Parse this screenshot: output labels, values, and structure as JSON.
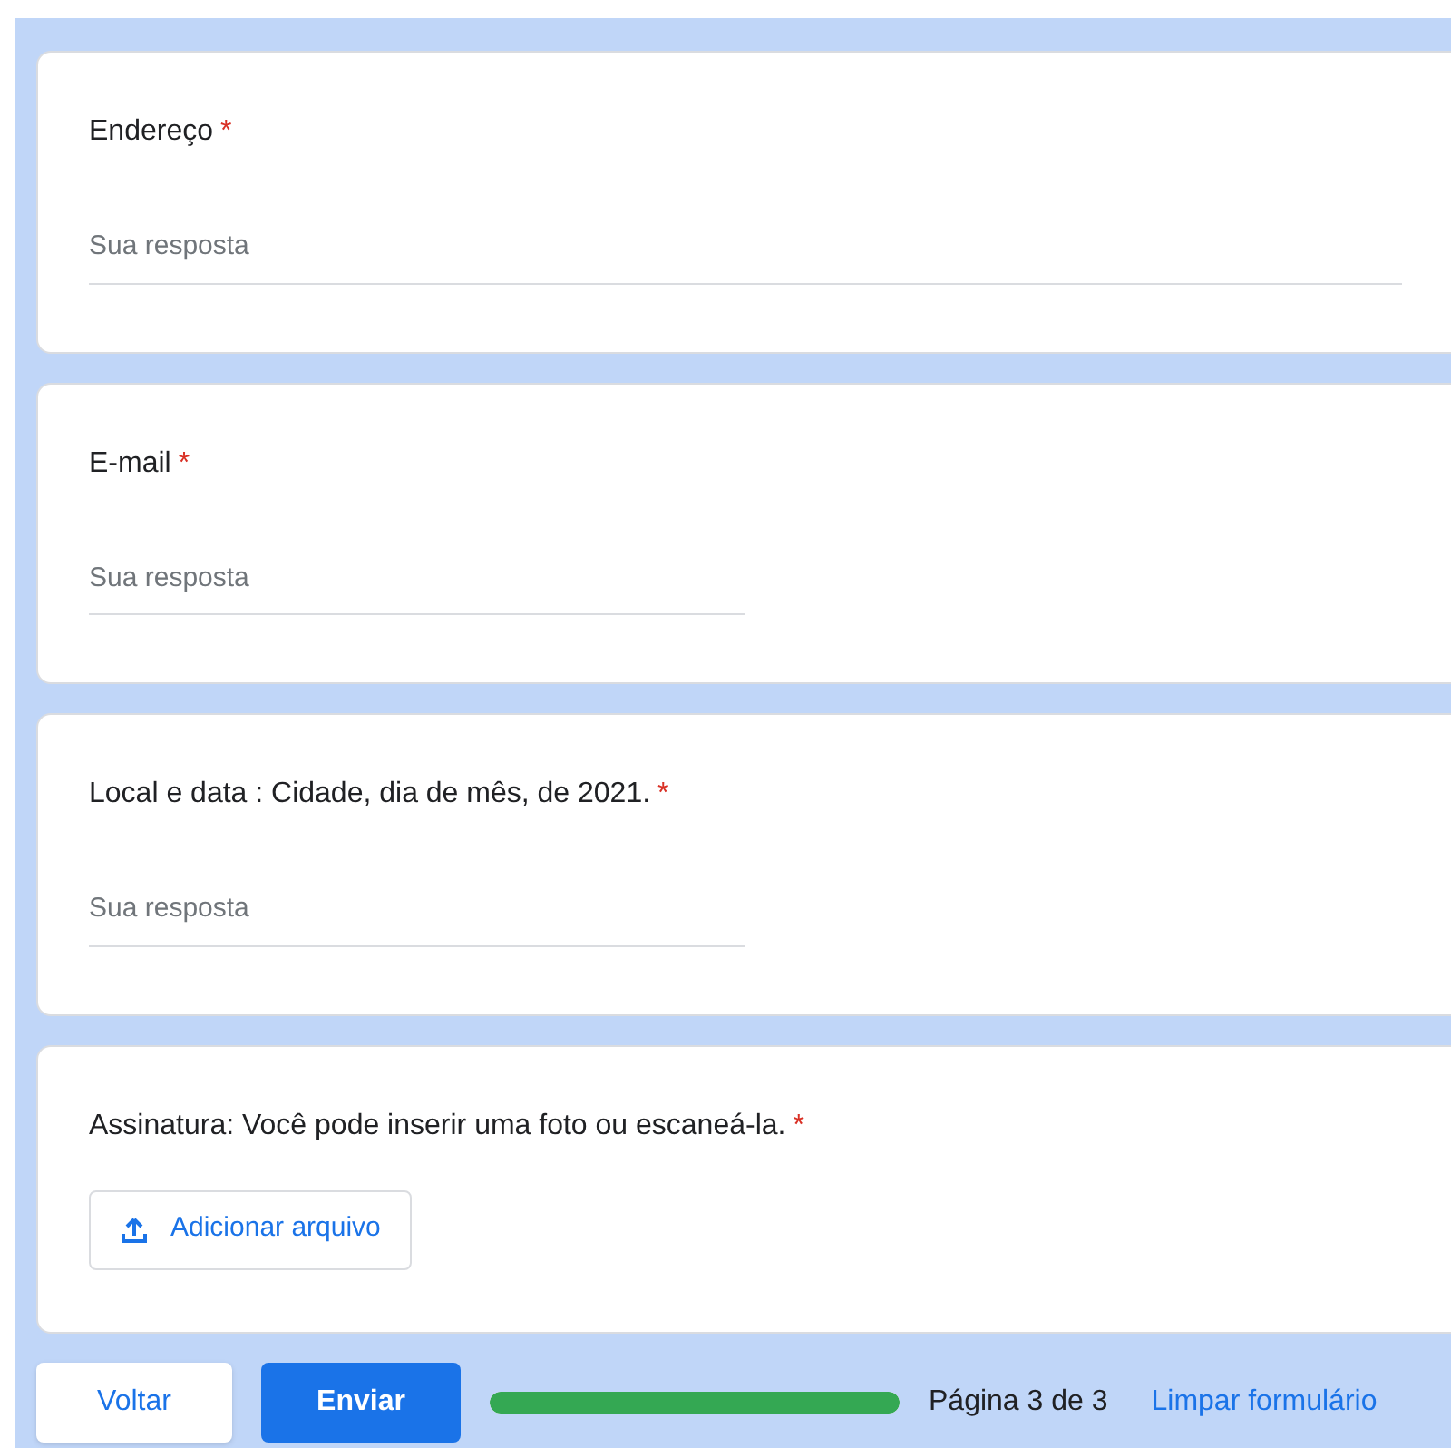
{
  "questions": [
    {
      "kind": "text",
      "title": "Endereço",
      "required_mark": "*",
      "wide": true,
      "placeholder": "Sua resposta"
    },
    {
      "kind": "text",
      "title": "E-mail",
      "required_mark": "*",
      "wide": false,
      "placeholder": "Sua resposta"
    },
    {
      "kind": "text",
      "title": "Local e data : Cidade, dia de mês, de 2021.",
      "required_mark": "*",
      "wide": false,
      "placeholder": "Sua resposta"
    },
    {
      "kind": "file",
      "title": "Assinatura: Você pode inserir uma foto ou escaneá-la.",
      "required_mark": "*",
      "button": "Adicionar arquivo"
    }
  ],
  "footer": {
    "back": "Voltar",
    "submit": "Enviar",
    "progress": {
      "level": 1
    },
    "page": "Página 3 de 3",
    "clear": "Limpar formulário"
  }
}
